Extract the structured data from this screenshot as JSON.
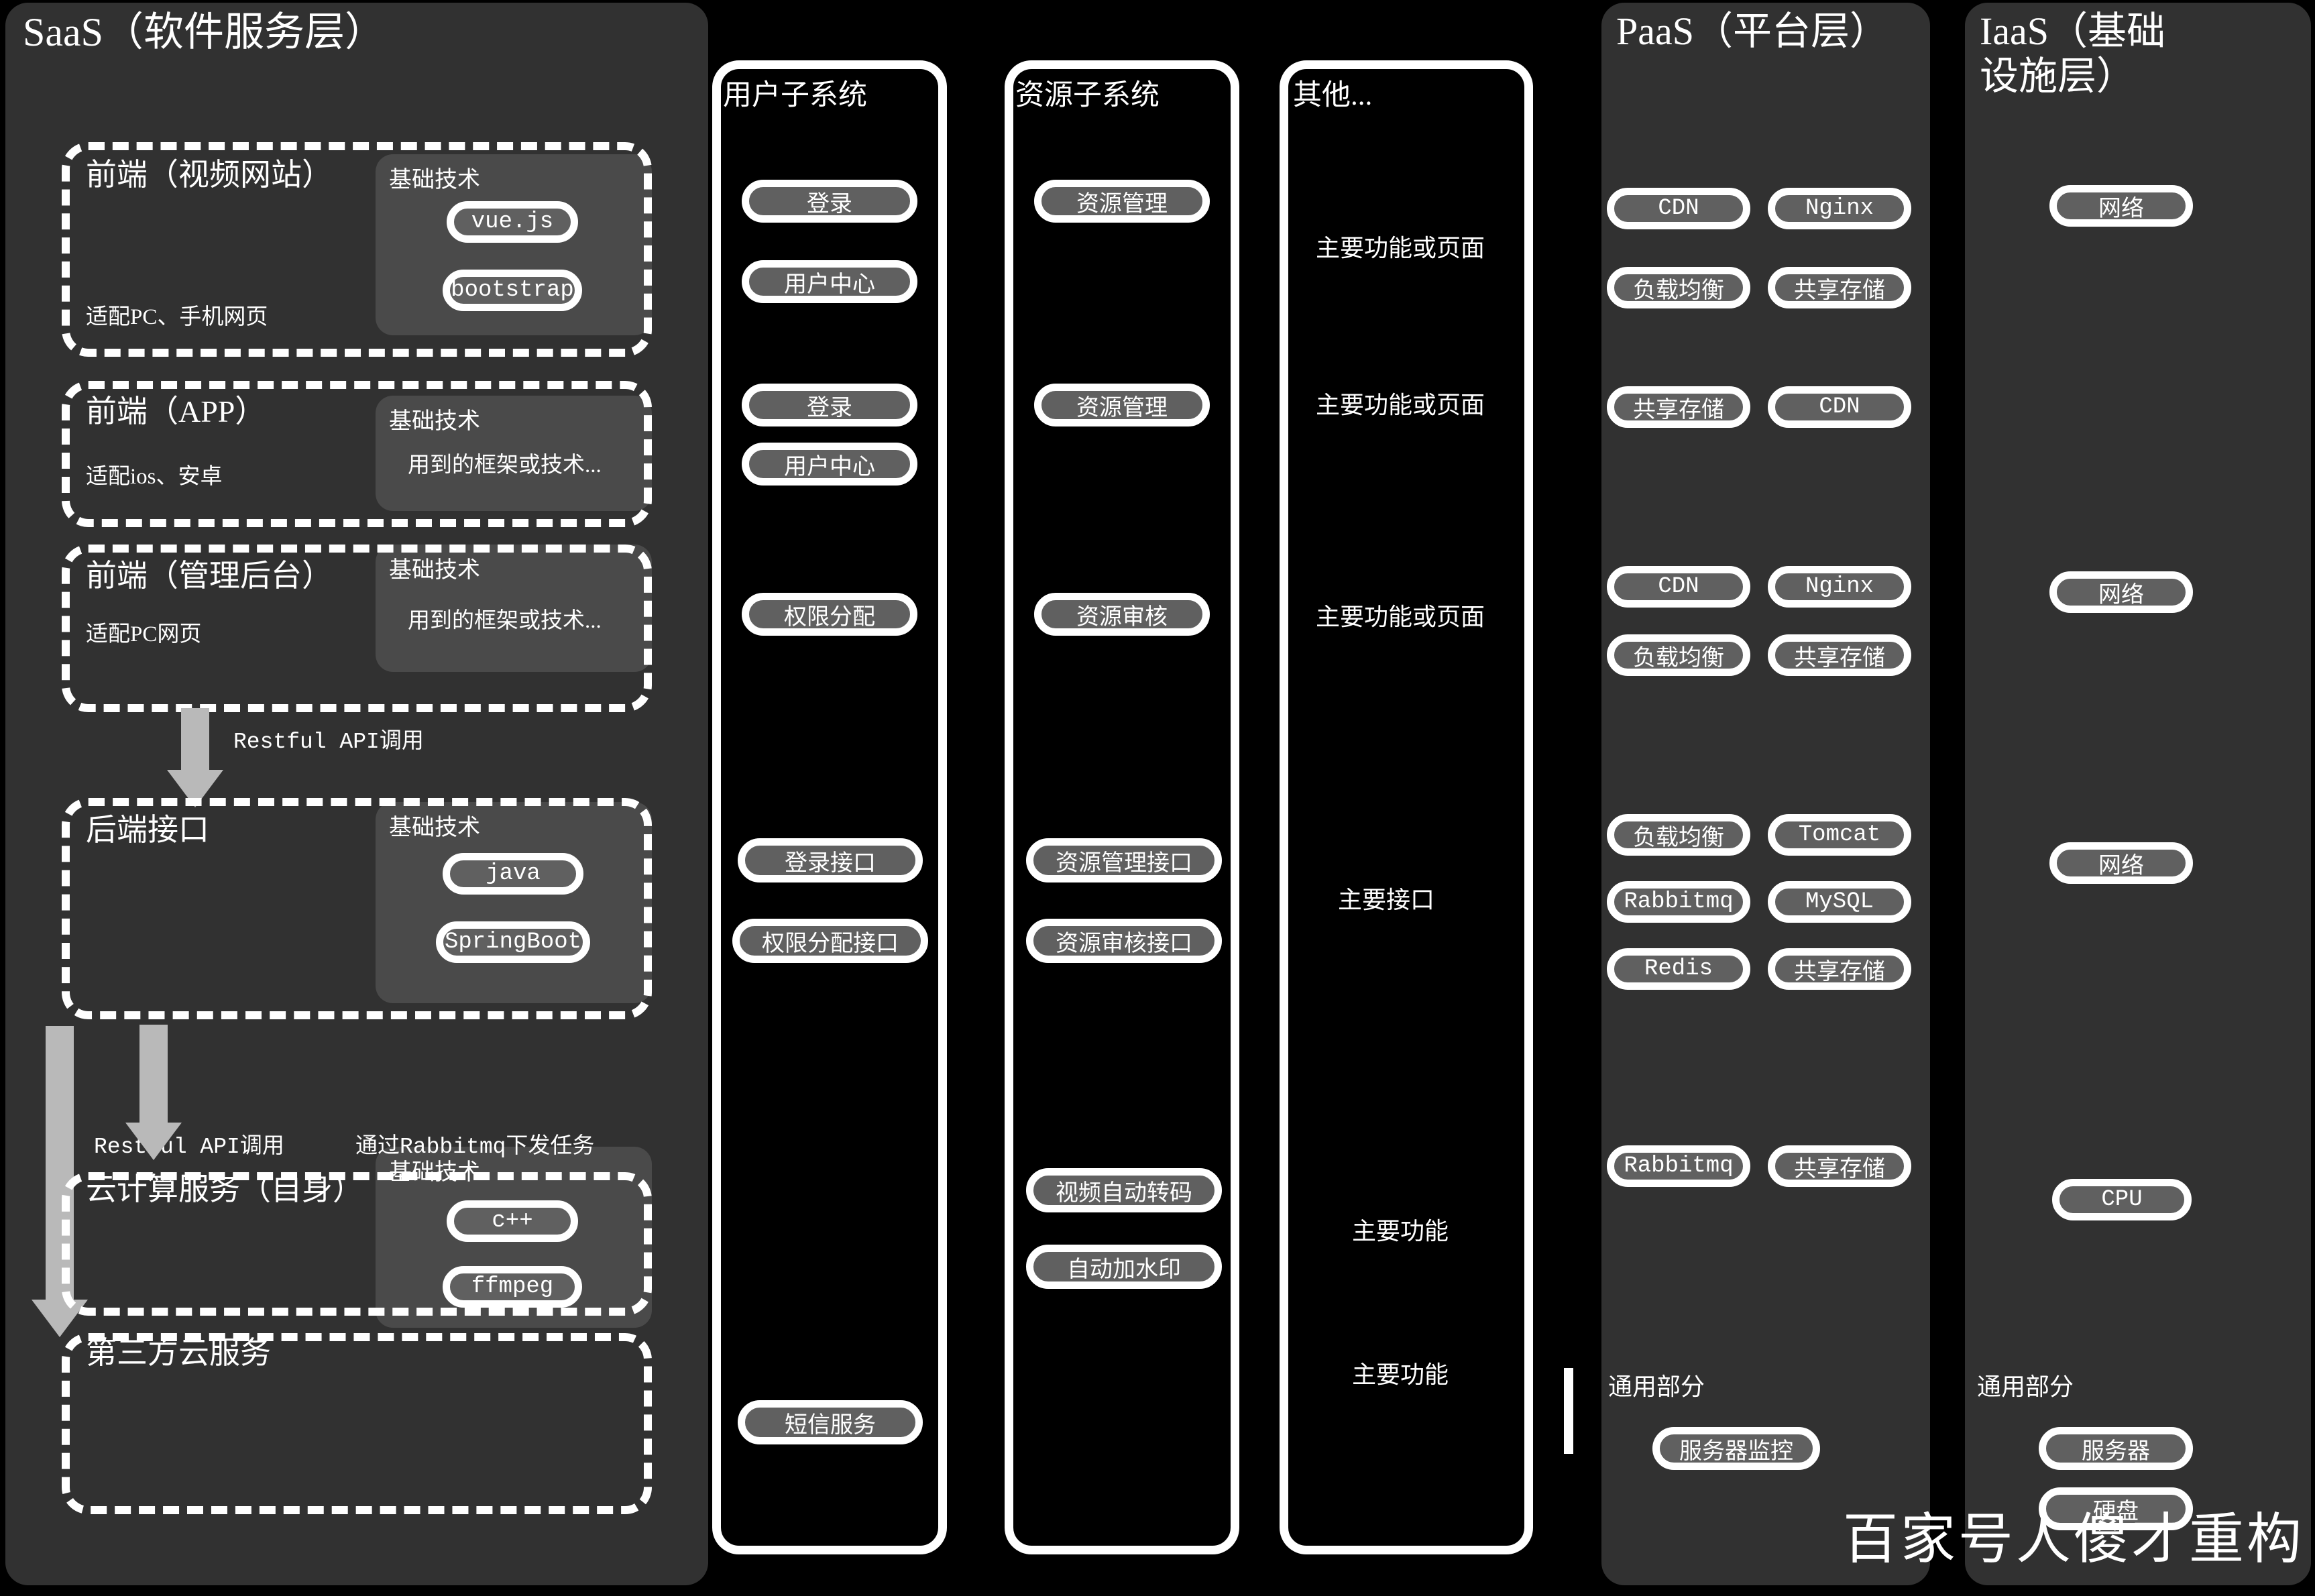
{
  "layers": {
    "saas": {
      "title": "SaaS（软件服务层）"
    },
    "paas": {
      "title": "PaaS（平台层）"
    },
    "iaas": {
      "title": "IaaS（基础\n设施层）"
    }
  },
  "subsystems": [
    {
      "header": "用户子系统"
    },
    {
      "header": "资源子系统"
    },
    {
      "header": "其他..."
    }
  ],
  "tech_label": "基础技术",
  "rows": [
    {
      "name": "前端（视频网站）",
      "sub": "适配PC、手机网页",
      "tech": [
        "vue.js",
        "bootstrap"
      ],
      "user": [
        "登录",
        "用户中心"
      ],
      "resource": [
        "资源管理"
      ],
      "other": "主要功能或页面",
      "paas": [
        "CDN",
        "Nginx",
        "负载均衡",
        "共享存储"
      ],
      "iaas": [
        "网络"
      ]
    },
    {
      "name": "前端（APP）",
      "sub": "适配ios、安卓",
      "tech": [
        "用到的框架或技术..."
      ],
      "user": [
        "登录",
        "用户中心"
      ],
      "resource": [
        "资源管理"
      ],
      "other": "主要功能或页面",
      "paas": [
        "共享存储",
        "CDN"
      ],
      "iaas": []
    },
    {
      "name": "前端（管理后台）",
      "sub": "适配PC网页",
      "tech": [
        "用到的框架或技术..."
      ],
      "user": [
        "权限分配"
      ],
      "resource": [
        "资源审核"
      ],
      "other": "主要功能或页面",
      "paas": [
        "CDN",
        "Nginx",
        "负载均衡",
        "共享存储"
      ],
      "iaas": [
        "网络"
      ]
    },
    {
      "name": "后端接口",
      "sub": "",
      "tech": [
        "java",
        "SpringBoot"
      ],
      "user": [
        "登录接口",
        "权限分配接口"
      ],
      "resource": [
        "资源管理接口",
        "资源审核接口"
      ],
      "other": "主要接口",
      "paas": [
        "负载均衡",
        "Tomcat",
        "Rabbitmq",
        "MySQL",
        "Redis",
        "共享存储"
      ],
      "iaas": [
        "网络"
      ]
    },
    {
      "name": "云计算服务（自身）",
      "sub": "",
      "tech": [
        "c++",
        "ffmpeg"
      ],
      "user": [],
      "resource": [
        "视频自动转码",
        "自动加水印"
      ],
      "other": "主要功能",
      "paas": [
        "Rabbitmq",
        "共享存储"
      ],
      "iaas": [
        "CPU"
      ]
    },
    {
      "name": "第三方云服务",
      "sub": "",
      "tech": [],
      "user": [
        "短信服务"
      ],
      "resource": [],
      "other": "主要功能",
      "paas": [],
      "iaas": []
    }
  ],
  "common": {
    "label": "通用部分",
    "paas_items": [
      "服务器监控"
    ],
    "iaas_items": [
      "服务器",
      "硬盘"
    ]
  },
  "arrows": [
    {
      "label": "Restful API调用"
    },
    {
      "label": "Restful API调用"
    },
    {
      "label": "通过Rabbitmq下发任务"
    }
  ],
  "watermark": "百家号人傻才重构",
  "colors": {
    "panel_bg": "#313131",
    "pill_bg": "#606060",
    "stroke": "#ffffff",
    "arrow": "#b9b9b9",
    "page_bg": "#000000"
  }
}
